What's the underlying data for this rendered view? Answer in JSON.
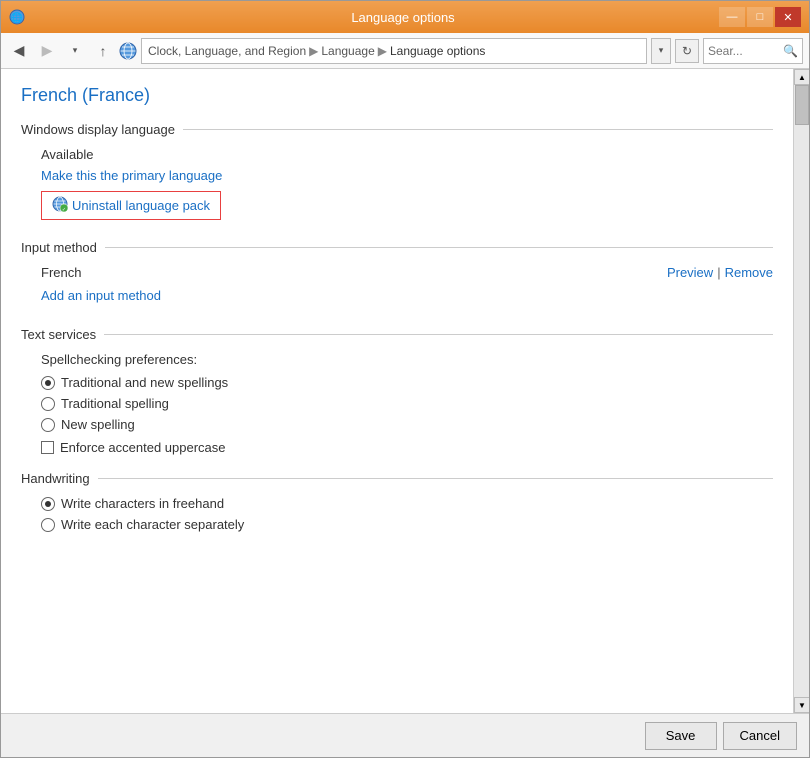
{
  "window": {
    "title": "Language options",
    "controls": {
      "minimize": "—",
      "maximize": "□",
      "close": "✕"
    }
  },
  "addressbar": {
    "back_icon": "◀",
    "forward_icon": "▶",
    "up_icon": "↑",
    "breadcrumbs": [
      "Clock, Language, and Region",
      "Language",
      "Language options"
    ],
    "dropdown_icon": "▾",
    "refresh_icon": "↻",
    "search_placeholder": "Sear...",
    "search_icon": "🔍"
  },
  "page": {
    "title": "French (France)"
  },
  "sections": {
    "windows_display": {
      "label": "Windows display language",
      "available_text": "Available",
      "make_primary_link": "Make this the primary language",
      "uninstall_label": "Uninstall language pack"
    },
    "input_method": {
      "label": "Input method",
      "language": "French",
      "preview_link": "Preview",
      "separator": "|",
      "remove_link": "Remove",
      "add_link": "Add an input method"
    },
    "text_services": {
      "label": "Text services",
      "spellcheck_label": "Spellchecking preferences:",
      "options": [
        {
          "id": "traditional-new",
          "label": "Traditional and new spellings",
          "checked": true
        },
        {
          "id": "traditional",
          "label": "Traditional spelling",
          "checked": false
        },
        {
          "id": "new-spelling",
          "label": "New spelling",
          "checked": false
        }
      ],
      "enforce_label": "Enforce accented uppercase",
      "enforce_checked": false
    },
    "handwriting": {
      "label": "Handwriting",
      "options": [
        {
          "id": "freehand",
          "label": "Write characters in freehand",
          "checked": true
        },
        {
          "id": "separate",
          "label": "Write each character separately",
          "checked": false
        }
      ]
    }
  },
  "footer": {
    "save_label": "Save",
    "cancel_label": "Cancel"
  }
}
